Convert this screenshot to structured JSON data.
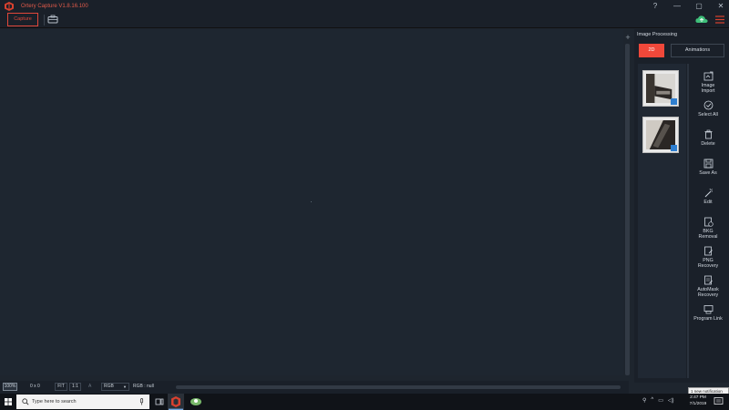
{
  "window": {
    "title": "Ortery Capture V1.8.16.100",
    "controls": [
      "?",
      "—",
      "▢",
      "✕"
    ]
  },
  "toolbar": {
    "capture_label": "Capture",
    "icons": [
      "briefcase-icon",
      "cloud-icon",
      "hamburger-menu-icon"
    ]
  },
  "right_panel": {
    "title": "Image Processing",
    "tabs": [
      {
        "label": "2D",
        "active": true
      },
      {
        "label": "Animations",
        "active": false
      }
    ],
    "tools": [
      {
        "label": "Image\nImport",
        "icon": "image-import-icon"
      },
      {
        "label": "Select All",
        "icon": "check-circle-icon"
      },
      {
        "label": "Delete",
        "icon": "trash-icon"
      },
      {
        "label": "Save As",
        "icon": "save-icon"
      },
      {
        "label": "Edit",
        "icon": "magic-wand-icon"
      },
      {
        "label": "BKG\nRemoval",
        "icon": "bkg-removal-icon"
      },
      {
        "label": "PNG\nRecovery",
        "icon": "png-recovery-icon"
      },
      {
        "label": "AutoMask\nRecovery",
        "icon": "automask-icon"
      },
      {
        "label": "Program Link",
        "icon": "program-link-icon"
      }
    ],
    "thumbnail_count": 2
  },
  "status_bar": {
    "zoom": "100%",
    "dimensions": "0 x 0",
    "fit_label": "FIT",
    "actual_label": "1:1",
    "a_label": "A",
    "color_mode": "RGB",
    "rgb_value": "RGB : null"
  },
  "notification": "1 new notification",
  "taskbar": {
    "search_placeholder": "Type here to search",
    "time": "2:47 PM",
    "date": "7/1/2019"
  },
  "colors": {
    "accent": "#f0483a",
    "background": "#1e252e",
    "panel": "#1a2029"
  }
}
